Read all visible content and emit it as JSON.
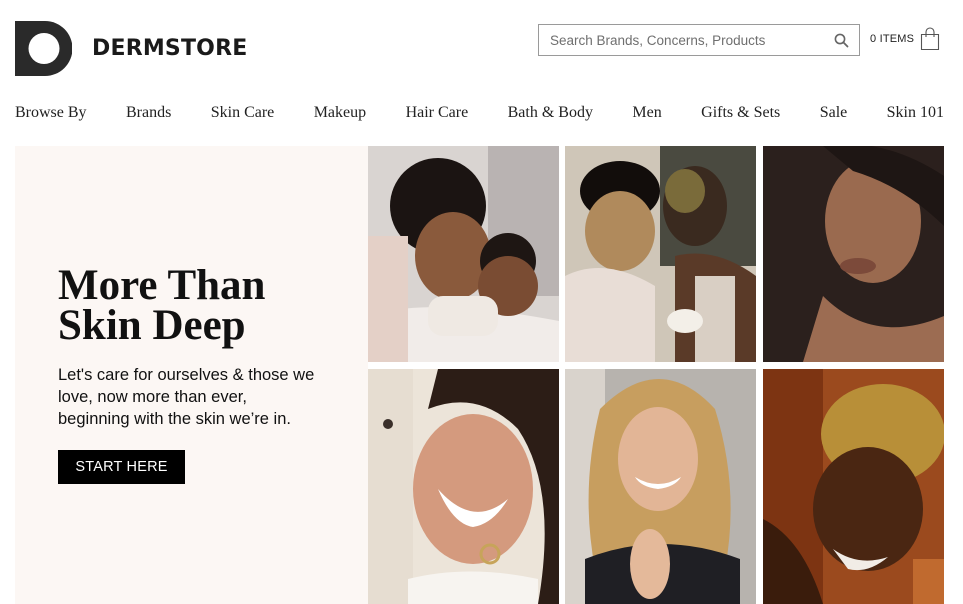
{
  "brand": {
    "name": "DERMSTORE"
  },
  "search": {
    "placeholder": "Search Brands, Concerns, Products",
    "icon": "search-icon"
  },
  "cart": {
    "count_label": "0 ITEMS",
    "icon": "shopping-bag-icon"
  },
  "nav": {
    "items": [
      {
        "label": "Browse By"
      },
      {
        "label": "Brands"
      },
      {
        "label": "Skin Care"
      },
      {
        "label": "Makeup"
      },
      {
        "label": "Hair Care"
      },
      {
        "label": "Bath & Body"
      },
      {
        "label": "Men"
      },
      {
        "label": "Gifts & Sets"
      },
      {
        "label": "Sale"
      },
      {
        "label": "Skin 101"
      }
    ]
  },
  "hero": {
    "title_line1": "More Than",
    "title_line2": "Skin Deep",
    "body": "Let's care for ourselves & those we love, now more than ever, beginning with the skin we’re in.",
    "cta_label": "START HERE",
    "panel_color": "#fcf7f4",
    "photos": [
      {
        "subject": "mother and child smiling in bed"
      },
      {
        "subject": "couple kissing with face masks"
      },
      {
        "subject": "woman with long dark hair"
      },
      {
        "subject": "woman laughing with hoop earrings"
      },
      {
        "subject": "blonde woman smiling"
      },
      {
        "subject": "man with bleached curly hair smiling"
      }
    ]
  },
  "colors": {
    "text": "#1a1a1a",
    "cta_bg": "#000000",
    "cta_text": "#ffffff",
    "border": "#9a9a9a"
  }
}
